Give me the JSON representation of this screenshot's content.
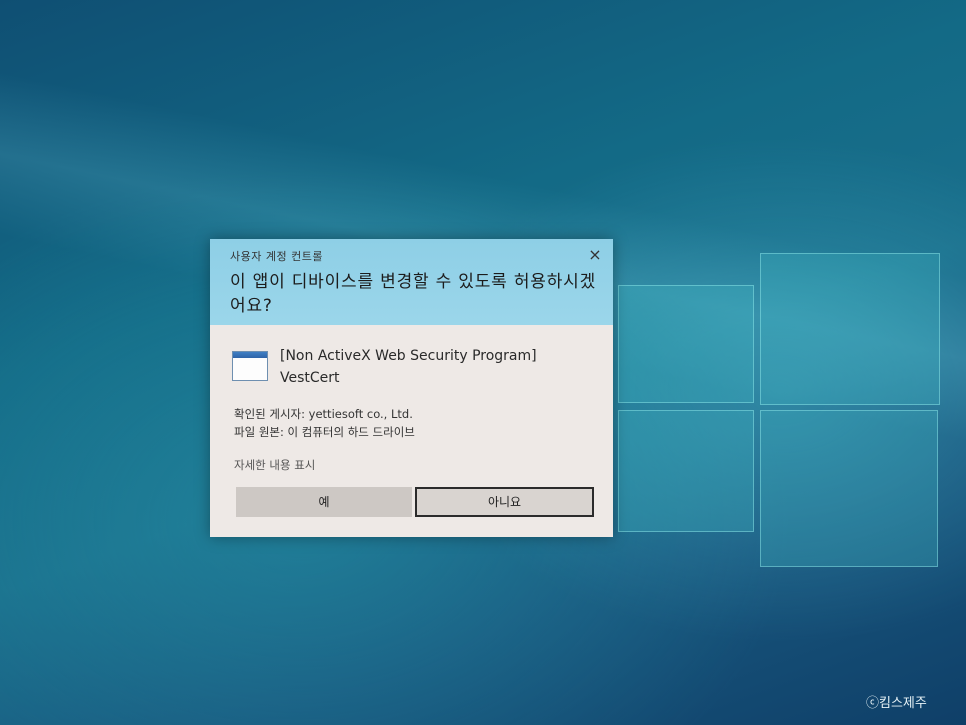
{
  "dialog": {
    "window_title": "사용자 계정 컨트롤",
    "close_symbol": "×",
    "question": "이 앱이 디바이스를 변경할 수 있도록 허용하시겠어요?",
    "program_name": "[Non ActiveX Web Security Program] VestCert",
    "publisher_line": "확인된 게시자: yettiesoft co., Ltd.",
    "origin_line": "파일 원본: 이 컴퓨터의 하드 드라이브",
    "details_link": "자세한 내용 표시",
    "yes_button": "예",
    "no_button": "아니요"
  },
  "watermark": "ⓒ킴스제주",
  "icons": [
    "window-icon",
    "close-icon"
  ]
}
